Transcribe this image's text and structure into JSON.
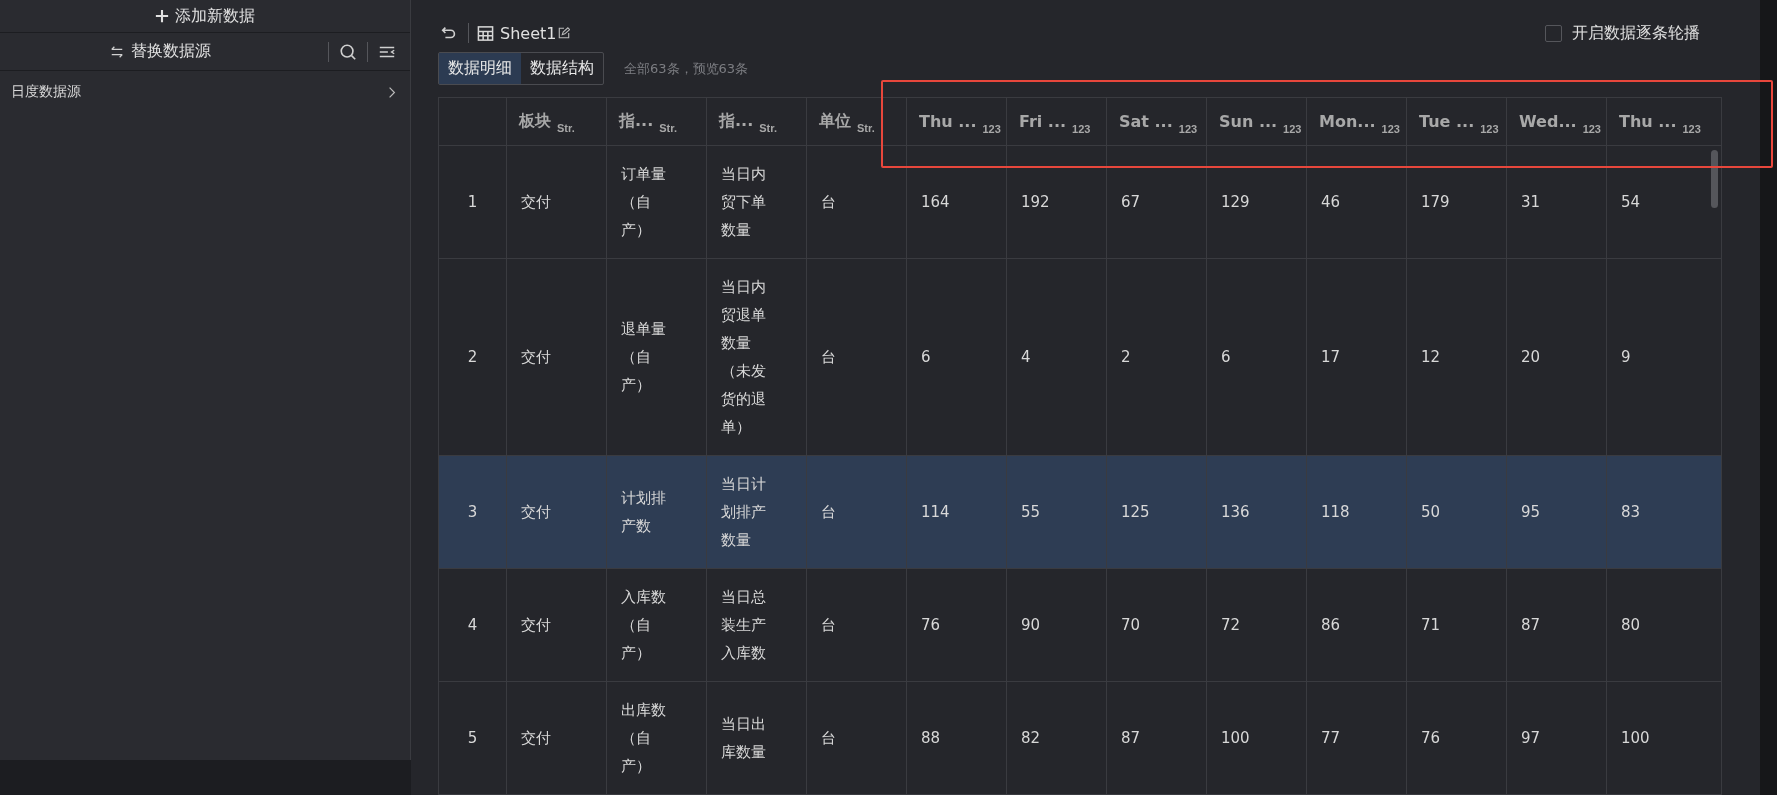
{
  "sidebar": {
    "add_button": "添加新数据",
    "replace_button": "替换数据源",
    "datasource": "日度数据源"
  },
  "toolbar": {
    "sheet_title": "Sheet1",
    "carousel": {
      "label": "开启数据逐条轮播",
      "checked": false
    }
  },
  "tabs": [
    {
      "label": "数据明细",
      "selected": true
    },
    {
      "label": "数据结构",
      "selected": false
    }
  ],
  "count_text": "全部63条，预览63条",
  "table": {
    "columns": [
      {
        "label": "板块",
        "type": "Str."
      },
      {
        "label": "指...",
        "type": "Str."
      },
      {
        "label": "指...",
        "type": "Str."
      },
      {
        "label": "单位",
        "type": "Str."
      },
      {
        "label": "Thu ...",
        "type": "123"
      },
      {
        "label": "Fri ...",
        "type": "123"
      },
      {
        "label": "Sat ...",
        "type": "123"
      },
      {
        "label": "Sun ...",
        "type": "123"
      },
      {
        "label": "Mon...",
        "type": "123"
      },
      {
        "label": "Tue ...",
        "type": "123"
      },
      {
        "label": "Wed...",
        "type": "123"
      },
      {
        "label": "Thu ...",
        "type": "123"
      }
    ],
    "rows": [
      {
        "index": "1",
        "selected": false,
        "cells": [
          "交付",
          "订单量（自产）",
          "当日内贸下单数量",
          "台",
          "164",
          "192",
          "67",
          "129",
          "46",
          "179",
          "31",
          "54"
        ]
      },
      {
        "index": "2",
        "selected": false,
        "cells": [
          "交付",
          "退单量（自产）",
          "当日内贸退单数量（未发货的退单）",
          "台",
          "6",
          "4",
          "2",
          "6",
          "17",
          "12",
          "20",
          "9"
        ]
      },
      {
        "index": "3",
        "selected": true,
        "cells": [
          "交付",
          "计划排产数",
          "当日计划排产数量",
          "台",
          "114",
          "55",
          "125",
          "136",
          "118",
          "50",
          "95",
          "83"
        ]
      },
      {
        "index": "4",
        "selected": false,
        "cells": [
          "交付",
          "入库数（自产）",
          "当日总装生产入库数",
          "台",
          "76",
          "90",
          "70",
          "72",
          "86",
          "71",
          "87",
          "80"
        ]
      },
      {
        "index": "5",
        "selected": false,
        "cells": [
          "交付",
          "出库数（自产）",
          "当日出库数量",
          "台",
          "88",
          "82",
          "87",
          "100",
          "77",
          "76",
          "97",
          "100"
        ]
      }
    ]
  }
}
